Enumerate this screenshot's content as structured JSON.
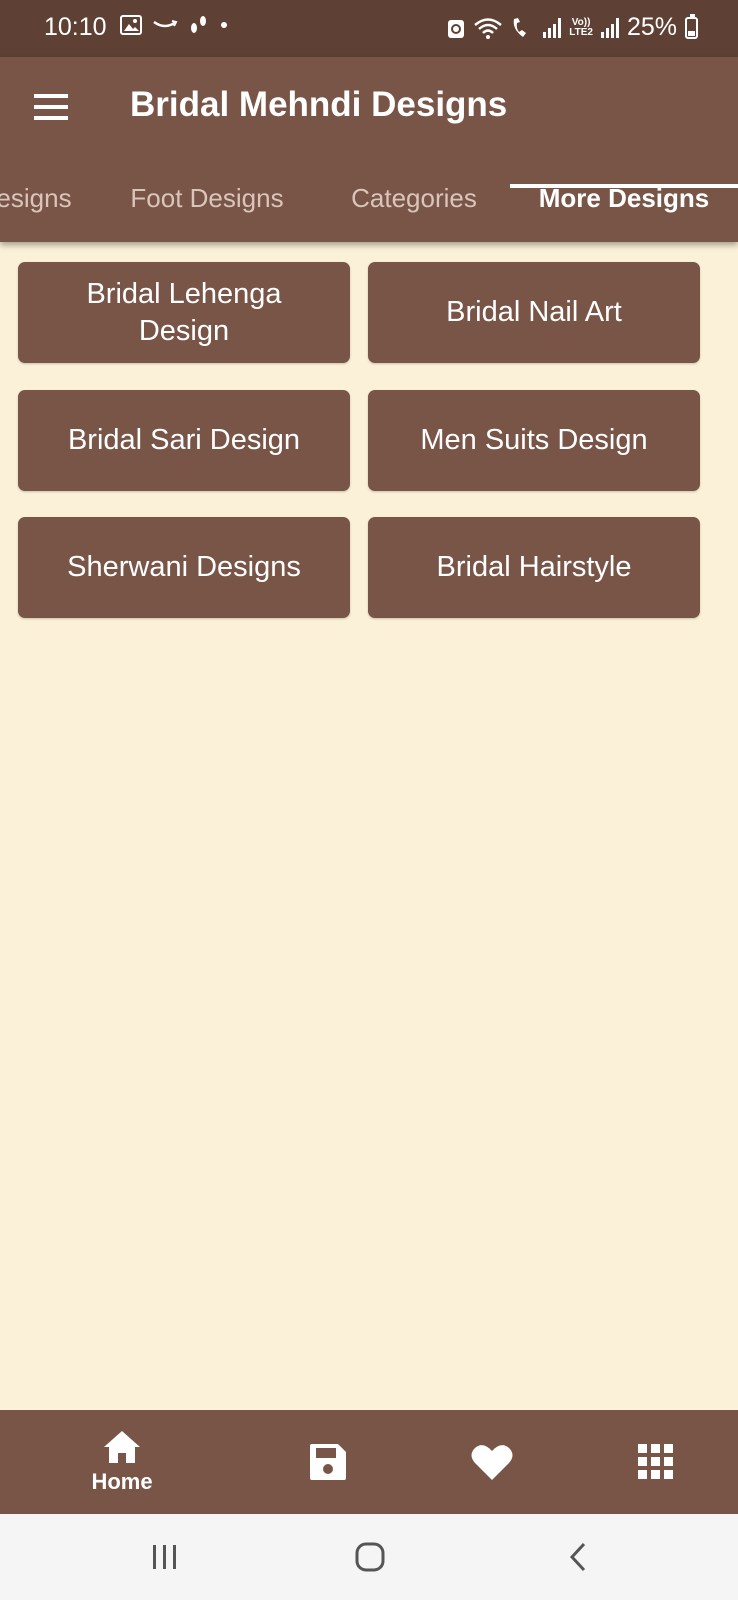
{
  "status_bar": {
    "time": "10:10",
    "battery": "25%",
    "volte_top": "Vo))",
    "volte_bottom": "LTE2"
  },
  "app_bar": {
    "title": "Bridal Mehndi Designs",
    "menu_icon": "hamburger-menu-icon"
  },
  "tabs": [
    {
      "label": "Hand Designs",
      "visible_text": "esigns",
      "active": false
    },
    {
      "label": "Foot Designs",
      "active": false
    },
    {
      "label": "Categories",
      "active": false
    },
    {
      "label": "More Designs",
      "active": true
    }
  ],
  "grid": {
    "items": [
      {
        "label": "Bridal Lehenga Design"
      },
      {
        "label": "Bridal Nail Art"
      },
      {
        "label": "Bridal Sari Design"
      },
      {
        "label": "Men Suits Design"
      },
      {
        "label": "Sherwani Designs"
      },
      {
        "label": "Bridal Hairstyle"
      }
    ]
  },
  "bottom_nav": {
    "items": [
      {
        "label": "Home",
        "icon": "home-icon",
        "active": true
      },
      {
        "label": "",
        "icon": "save-icon",
        "active": false
      },
      {
        "label": "",
        "icon": "heart-icon",
        "active": false
      },
      {
        "label": "",
        "icon": "grid-apps-icon",
        "active": false
      }
    ]
  },
  "system_nav": [
    "recent-apps-icon",
    "home-circle-icon",
    "back-icon"
  ],
  "colors": {
    "status_bar": "#5E4134",
    "primary": "#795548",
    "background": "#FBF1D9",
    "system_nav": "#F5F5F5"
  }
}
